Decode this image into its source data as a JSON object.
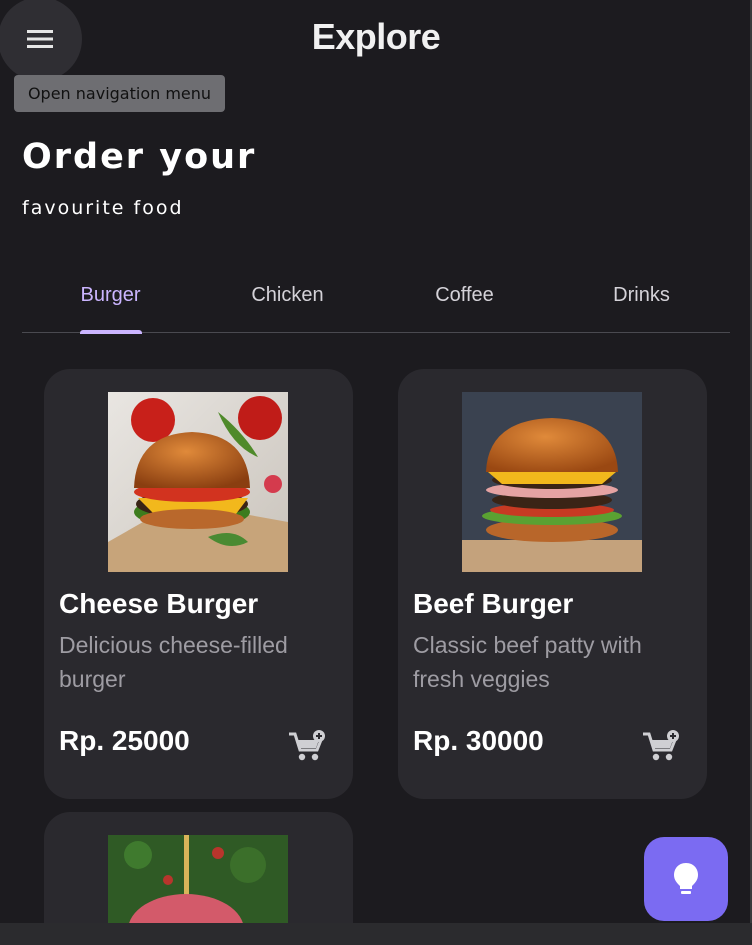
{
  "app_bar": {
    "title": "Explore",
    "menu_icon": "menu-icon",
    "tooltip": "Open navigation menu"
  },
  "hero": {
    "headline": "Order your",
    "subheadline": "favourite food"
  },
  "tabs": [
    {
      "label": "Burger",
      "active": true
    },
    {
      "label": "Chicken",
      "active": false
    },
    {
      "label": "Coffee",
      "active": false
    },
    {
      "label": "Drinks",
      "active": false
    }
  ],
  "products": [
    {
      "name": "Cheese Burger",
      "description": "Delicious cheese-filled burger",
      "price": "Rp. 25000",
      "cart_icon": "add-shopping-cart-icon"
    },
    {
      "name": "Beef Burger",
      "description": "Classic beef patty with fresh veggies",
      "price": "Rp. 30000",
      "cart_icon": "add-shopping-cart-icon"
    }
  ],
  "fab": {
    "icon": "lightbulb-icon"
  },
  "colors": {
    "background": "#1c1b1f",
    "card": "#2a292e",
    "accent": "#cbb5ff",
    "fab": "#7b6bf2",
    "tooltip": "#6e6e72"
  }
}
